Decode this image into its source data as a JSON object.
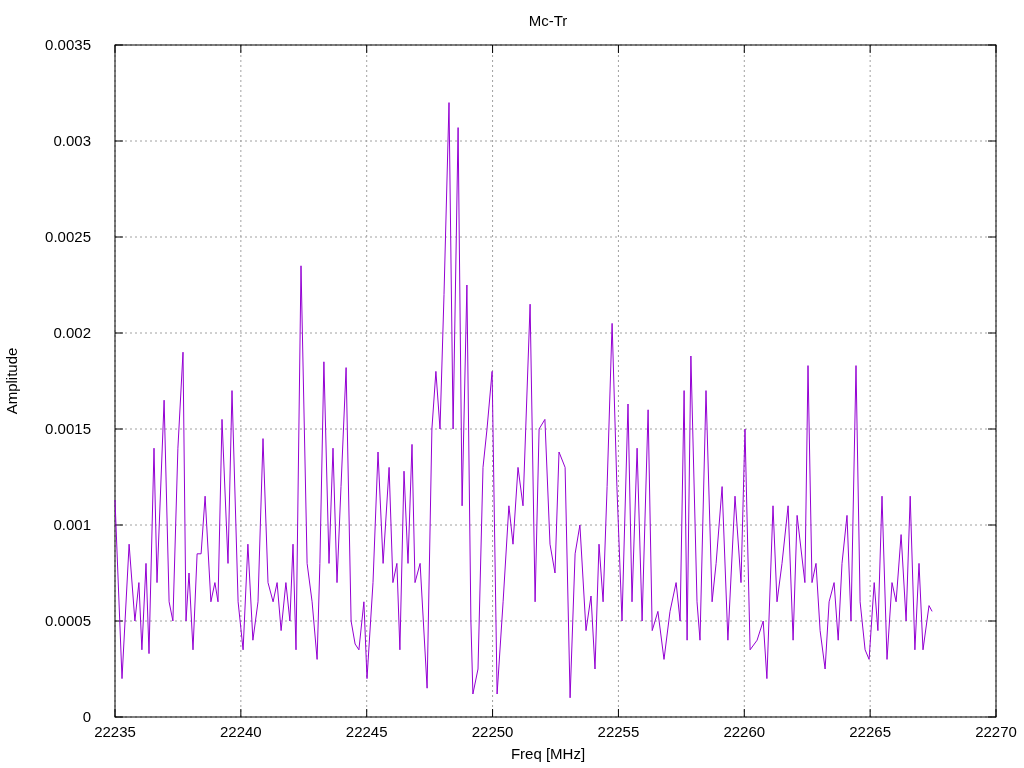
{
  "chart_data": {
    "type": "line",
    "grid": true,
    "title": "Mc-Tr",
    "xlabel": "Freq [MHz]",
    "ylabel": "Amplitude",
    "xlim": [
      22235,
      22270
    ],
    "ylim": [
      0,
      0.0035
    ],
    "xticks": [
      22235,
      22240,
      22245,
      22250,
      22255,
      22260,
      22265,
      22270
    ],
    "yticks": [
      0,
      0.0005,
      0.001,
      0.0015,
      0.002,
      0.0025,
      0.003,
      0.0035
    ],
    "x": [
      22235.0,
      22235.28,
      22235.56,
      22235.79,
      22235.95,
      22236.07,
      22236.23,
      22236.35,
      22236.55,
      22236.67,
      22236.95,
      22237.15,
      22237.3,
      22237.5,
      22237.7,
      22237.82,
      22237.94,
      22238.1,
      22238.26,
      22238.42,
      22238.58,
      22238.81,
      22238.97,
      22239.09,
      22239.25,
      22239.49,
      22239.65,
      22239.89,
      22240.09,
      22240.28,
      22240.48,
      22240.68,
      22240.88,
      22241.08,
      22241.28,
      22241.44,
      22241.6,
      22241.79,
      22241.95,
      22242.07,
      22242.19,
      22242.39,
      22242.63,
      22242.83,
      22243.03,
      22243.14,
      22243.3,
      22243.5,
      22243.66,
      22243.82,
      22243.98,
      22244.18,
      22244.38,
      22244.54,
      22244.69,
      22244.89,
      22245.01,
      22245.25,
      22245.45,
      22245.65,
      22245.89,
      22246.04,
      22246.2,
      22246.32,
      22246.48,
      22246.64,
      22246.8,
      22246.92,
      22247.12,
      22247.4,
      22247.59,
      22247.75,
      22247.91,
      22248.07,
      22248.27,
      22248.43,
      22248.63,
      22248.79,
      22248.98,
      22249.14,
      22249.22,
      22249.42,
      22249.62,
      22249.78,
      22249.98,
      22250.18,
      22250.42,
      22250.65,
      22250.81,
      22251.01,
      22251.21,
      22251.49,
      22251.69,
      22251.85,
      22252.08,
      22252.28,
      22252.48,
      22252.64,
      22252.88,
      22253.08,
      22253.28,
      22253.47,
      22253.71,
      22253.91,
      22254.07,
      22254.23,
      22254.39,
      22254.55,
      22254.75,
      22254.94,
      22255.14,
      22255.38,
      22255.54,
      22255.74,
      22255.94,
      22256.18,
      22256.34,
      22256.57,
      22256.81,
      22257.05,
      22257.29,
      22257.45,
      22257.61,
      22257.73,
      22257.88,
      22258.12,
      22258.24,
      22258.48,
      22258.72,
      22258.88,
      22259.12,
      22259.35,
      22259.63,
      22259.87,
      22260.03,
      22260.23,
      22260.51,
      22260.75,
      22260.9,
      22261.14,
      22261.3,
      22261.5,
      22261.74,
      22261.94,
      22262.1,
      22262.41,
      22262.53,
      22262.69,
      22262.85,
      22263.01,
      22263.21,
      22263.37,
      22263.57,
      22263.73,
      22263.88,
      22264.08,
      22264.24,
      22264.44,
      22264.6,
      22264.8,
      22264.96,
      22265.16,
      22265.31,
      22265.47,
      22265.67,
      22265.87,
      22266.03,
      22266.23,
      22266.43,
      22266.59,
      22266.78,
      22266.94,
      22267.1,
      22267.34,
      22267.46
    ],
    "series": [
      {
        "color": "#9400d3",
        "values": [
          0.00113,
          0.0002,
          0.0009,
          0.0005,
          0.0007,
          0.00035,
          0.0008,
          0.00033,
          0.0014,
          0.0007,
          0.00165,
          0.0006,
          0.0005,
          0.0014,
          0.0019,
          0.0005,
          0.00075,
          0.00035,
          0.00085,
          0.00085,
          0.00115,
          0.0006,
          0.0007,
          0.0006,
          0.00155,
          0.0008,
          0.0017,
          0.0006,
          0.00035,
          0.0009,
          0.0004,
          0.0006,
          0.00145,
          0.0007,
          0.0006,
          0.0007,
          0.00045,
          0.0007,
          0.0005,
          0.0009,
          0.00035,
          0.00235,
          0.0008,
          0.0006,
          0.0003,
          0.0008,
          0.00185,
          0.0008,
          0.0014,
          0.0007,
          0.0012,
          0.00182,
          0.0005,
          0.00038,
          0.00035,
          0.0006,
          0.0002,
          0.0007,
          0.00138,
          0.0008,
          0.0013,
          0.0007,
          0.0008,
          0.00035,
          0.00128,
          0.0008,
          0.00142,
          0.0007,
          0.0008,
          0.00015,
          0.0015,
          0.0018,
          0.0015,
          0.0022,
          0.0032,
          0.0015,
          0.00307,
          0.0011,
          0.00225,
          0.0005,
          0.00012,
          0.00025,
          0.0013,
          0.0015,
          0.0018,
          0.00012,
          0.0006,
          0.0011,
          0.0009,
          0.0013,
          0.0011,
          0.00215,
          0.0006,
          0.0015,
          0.00155,
          0.0009,
          0.00075,
          0.00138,
          0.0013,
          0.0001,
          0.00085,
          0.001,
          0.00045,
          0.00063,
          0.00025,
          0.0009,
          0.0006,
          0.0012,
          0.00205,
          0.0012,
          0.0005,
          0.00163,
          0.0006,
          0.0014,
          0.0005,
          0.0016,
          0.00045,
          0.00055,
          0.0003,
          0.00055,
          0.0007,
          0.0005,
          0.0017,
          0.0004,
          0.00188,
          0.0006,
          0.0004,
          0.0017,
          0.0006,
          0.0008,
          0.0012,
          0.0004,
          0.00115,
          0.0007,
          0.0015,
          0.00035,
          0.0004,
          0.0005,
          0.0002,
          0.0011,
          0.0006,
          0.0008,
          0.0011,
          0.0004,
          0.00105,
          0.0007,
          0.00183,
          0.0007,
          0.0008,
          0.00045,
          0.00025,
          0.0006,
          0.0007,
          0.0004,
          0.0008,
          0.00105,
          0.0005,
          0.00183,
          0.0006,
          0.00035,
          0.0003,
          0.0007,
          0.00045,
          0.00115,
          0.0003,
          0.0007,
          0.0006,
          0.00095,
          0.0005,
          0.00115,
          0.00035,
          0.0008,
          0.00035,
          0.00058,
          0.00055
        ]
      }
    ]
  }
}
